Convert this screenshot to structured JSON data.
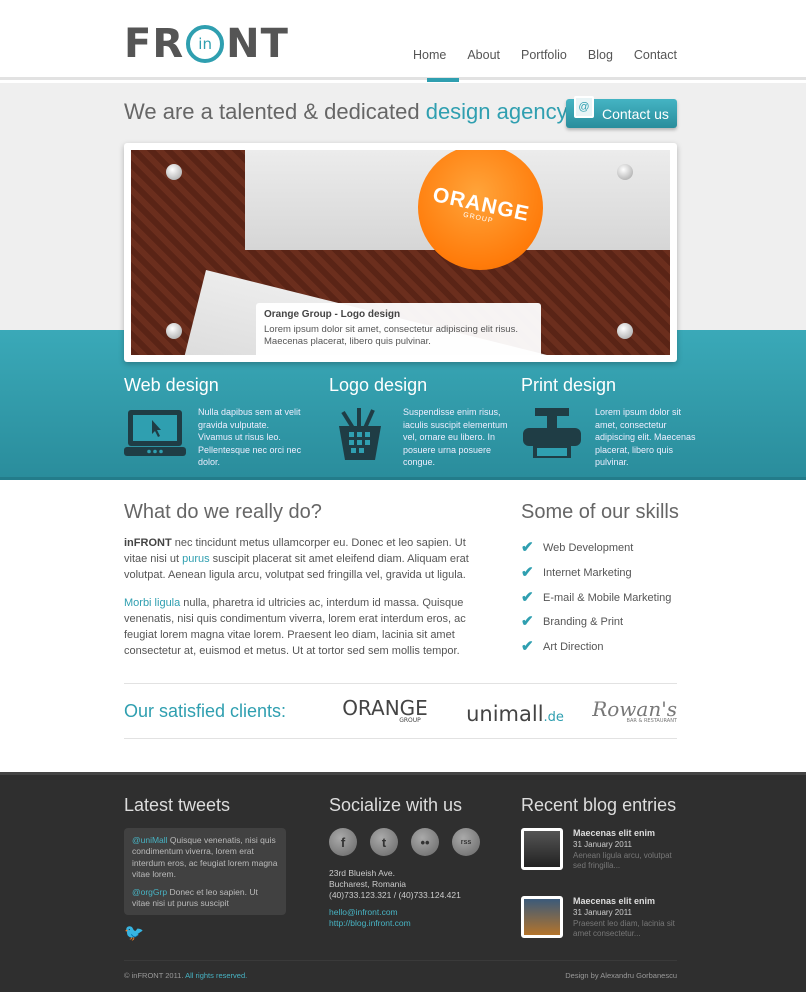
{
  "header": {
    "logo_left": "FR",
    "logo_center": "in",
    "logo_right": "NT",
    "nav": [
      "Home",
      "About",
      "Portfolio",
      "Blog",
      "Contact"
    ]
  },
  "hero": {
    "tagline_part1": "We are a talented & dedicated",
    "tagline_accent": "design agency",
    "contact_button": "Contact us",
    "slide": {
      "logo_text": "ORANGE",
      "logo_sub": "GROUP",
      "caption_title": "Orange Group - Logo design",
      "caption_text": "Lorem ipsum dolor sit amet, consectetur adipiscing elit risus. Maecenas placerat, libero quis pulvinar."
    }
  },
  "services": [
    {
      "title": "Web design",
      "text": "Nulla dapibus sem at velit gravida vulputate. Vivamus ut risus leo. Pellentesque nec orci nec dolor.",
      "icon": "laptop-icon"
    },
    {
      "title": "Logo design",
      "text": "Suspendisse enim risus, iaculis suscipit elementum vel, ornare eu libero. In posuere urna posuere congue.",
      "icon": "pencil-cup-icon"
    },
    {
      "title": "Print design",
      "text": "Lorem ipsum dolor sit amet, consectetur adipiscing elit. Maecenas placerat, libero quis pulvinar.",
      "icon": "printer-icon"
    }
  ],
  "main": {
    "what_title": "What do we really do?",
    "para1_bold": "inFRONT",
    "para1_a": " nec tincidunt metus ullamcorper eu. Donec et leo sapien. Ut vitae nisi ut ",
    "para1_link": "purus",
    "para1_b": " suscipit placerat sit amet eleifend diam. Aliquam erat volutpat. Aenean ligula arcu, volutpat sed fringilla vel, gravida ut ligula.",
    "para2_link": "Morbi ligula",
    "para2_text": " nulla, pharetra id ultricies ac, interdum id massa. Quisque venenatis, nisi quis condimentum viverra, lorem erat interdum eros, ac feugiat lorem magna vitae lorem. Praesent leo diam, lacinia sit amet consectetur at, euismod et metus. Ut at tortor sed sem mollis tempor.",
    "skills_title": "Some of our skills",
    "skills": [
      "Web Development",
      "Internet Marketing",
      "E-mail & Mobile Marketing",
      "Branding & Print",
      "Art Direction"
    ],
    "clients_label": "Our satisfied clients:",
    "clients": [
      "ORANGE",
      "GROUP",
      "unimall",
      ".de",
      "Rowan's",
      "BAR & RESTAURANT"
    ]
  },
  "footer": {
    "tweets_title": "Latest tweets",
    "tweet1_handle": "@uniMall",
    "tweet1_text": " Quisque venenatis, nisi quis condimentum viverra, lorem erat interdum eros, ac feugiat lorem magna vitae lorem.",
    "tweet2_handle": "@orgGrp",
    "tweet2_text": " Donec et leo sapien. Ut vitae nisi ut purus suscipit",
    "social_title": "Socialize with us",
    "social_icons": [
      "f",
      "t",
      "••",
      "rss"
    ],
    "address_line1": "23rd Blueish Ave.",
    "address_line2": "Bucharest, Romania",
    "phones": "(40)733.123.321 / (40)733.124.421",
    "email": "hello@infront.com",
    "blog_url": "http://blog.infront.com",
    "blog_title": "Recent blog entries",
    "blog": [
      {
        "title": "Maecenas elit enim",
        "date": "31 January 2011",
        "excerpt": "Aenean ligula arcu, volutpat sed fringilla..."
      },
      {
        "title": "Maecenas elit enim",
        "date": "31 January 2011",
        "excerpt": "Praesent leo diam, lacinia sit amet consectetur..."
      }
    ],
    "copyright": "© inFRONT 2011.",
    "rights": "All rights reserved.",
    "credit": "Design by Alexandru Gorbanescu"
  },
  "colors": {
    "accent": "#2f9fb0",
    "footer_bg": "#2f2f2f"
  }
}
